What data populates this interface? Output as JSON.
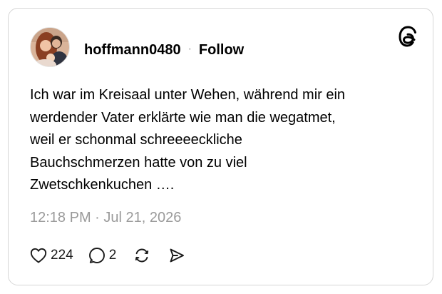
{
  "post": {
    "username": "hoffmann0480",
    "separator": "·",
    "follow_label": "Follow",
    "text_lines": [
      "Ich war im Kreisaal unter Wehen, während mir ein",
      "werdender Vater erklärte wie man die wegatmet,",
      "weil er schonmal schreeeeckliche",
      "Bauchschmerzen hatte von zu viel",
      "Zwetschkenkuchen …."
    ],
    "timestamp": "12:18 PM · Jul 21, 2026",
    "likes": "224",
    "replies": "2"
  },
  "icons": {
    "brand": "threads-logo-icon",
    "like": "heart-icon",
    "reply": "speech-bubble-icon",
    "repost": "repost-icon",
    "share": "send-icon"
  },
  "colors": {
    "border": "#d6d6d6",
    "muted_text": "#9a9a9a",
    "text": "#000000"
  }
}
